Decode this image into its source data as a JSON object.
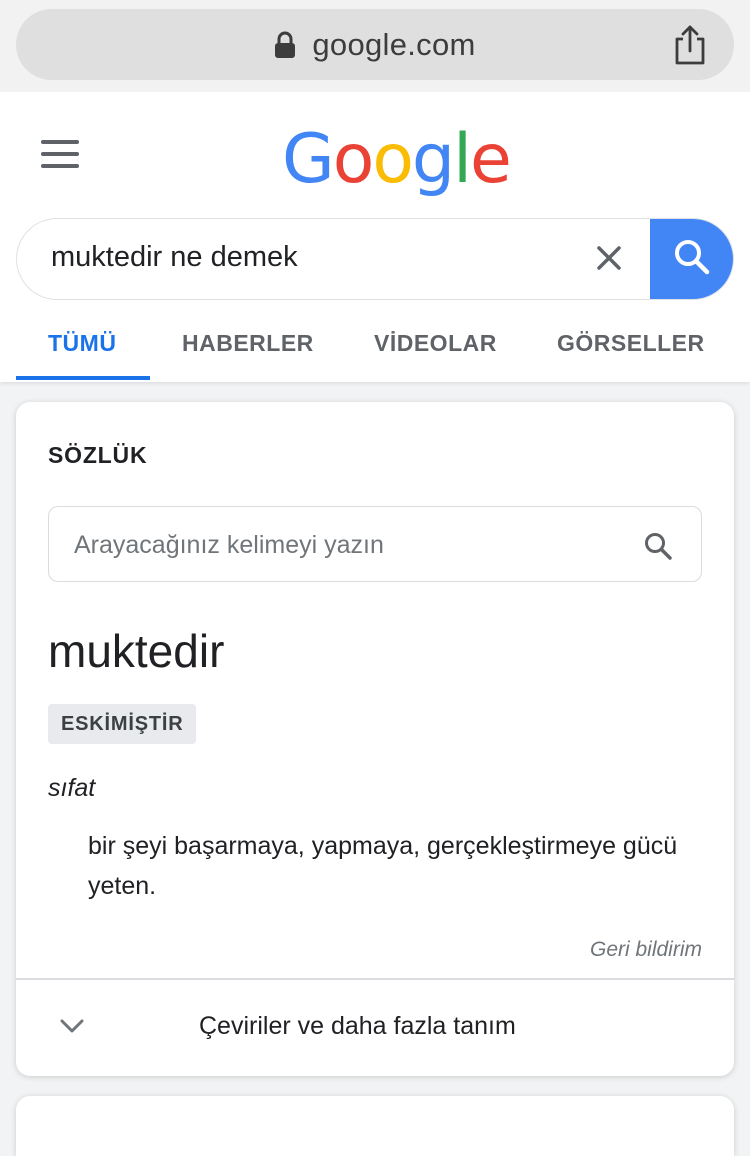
{
  "browser": {
    "url": "google.com",
    "lock_icon": "lock-icon",
    "share_icon": "share-icon"
  },
  "header": {
    "menu_icon": "hamburger-menu-icon",
    "logo_letters": [
      "G",
      "o",
      "o",
      "g",
      "l",
      "e"
    ],
    "logo_colors": [
      "#4285F4",
      "#EA4335",
      "#FBBC05",
      "#4285F4",
      "#34A853",
      "#EA4335"
    ]
  },
  "search": {
    "query": "muktedir ne demek",
    "clear_icon": "close-icon",
    "search_icon": "search-icon",
    "button_color": "#4285F4"
  },
  "tabs": [
    {
      "label": "TÜMÜ",
      "active": true
    },
    {
      "label": "HABERLER",
      "active": false
    },
    {
      "label": "VİDEOLAR",
      "active": false
    },
    {
      "label": "GÖRSELLER",
      "active": false
    }
  ],
  "dictionary": {
    "heading": "SÖZLÜK",
    "input_placeholder": "Arayacağınız kelimeyi yazın",
    "word": "muktedir",
    "badge": "ESKİMİŞTİR",
    "part_of_speech": "sıfat",
    "definition": "bir şeyi başarmaya, yapmaya, gerçekleştirmeye gücü yeten.",
    "feedback": "Geri bildirim",
    "expand_label": "Çeviriler ve daha fazla tanım"
  },
  "colors": {
    "accent": "#1A73E8",
    "text": "#202124",
    "muted": "#5F6368"
  }
}
